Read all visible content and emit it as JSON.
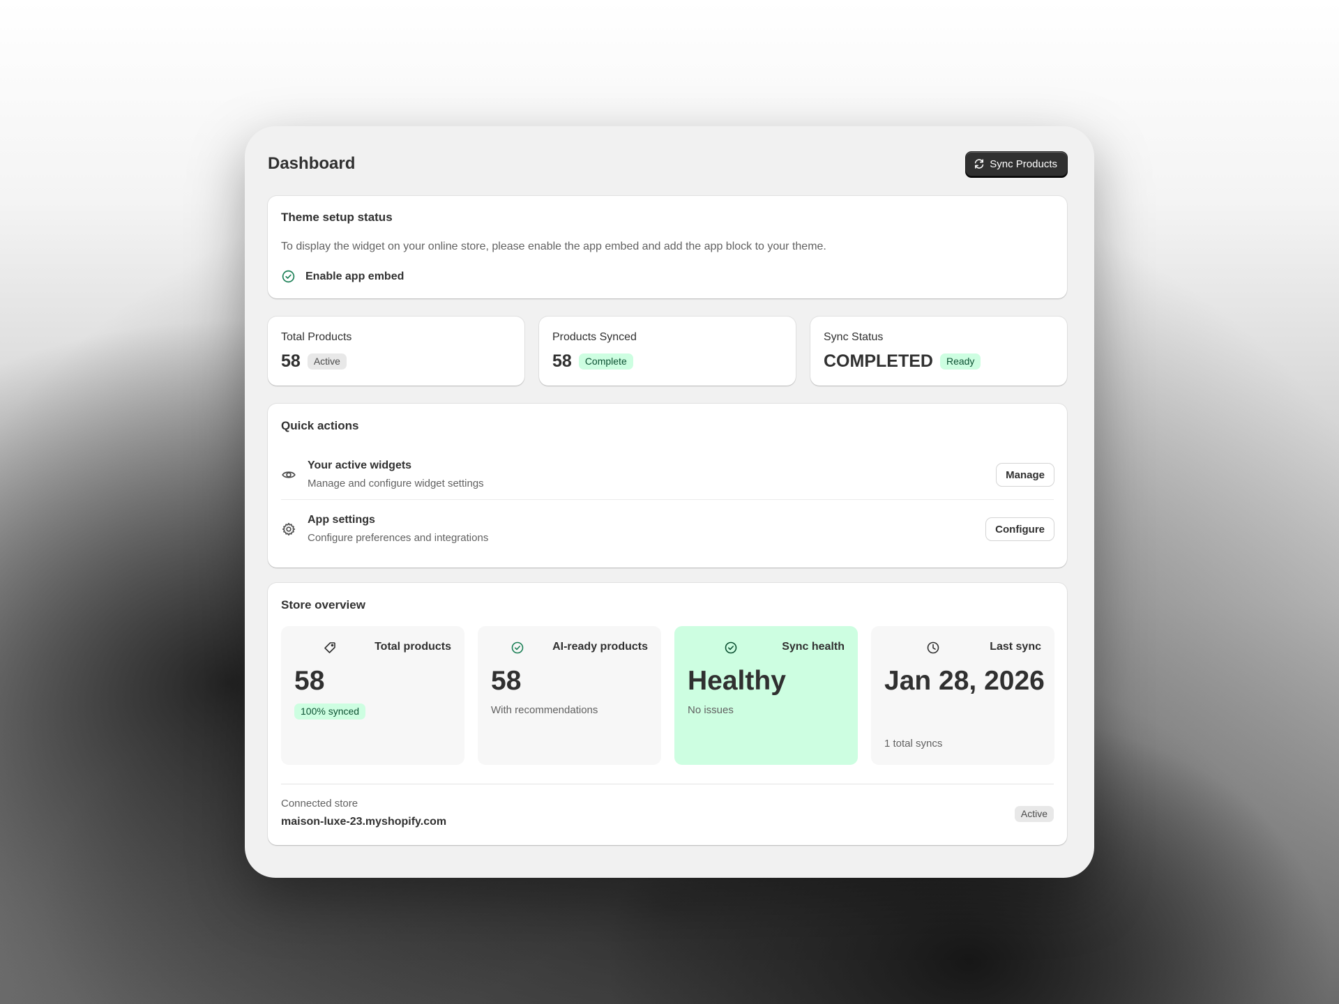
{
  "header": {
    "title": "Dashboard",
    "sync_button": "Sync Products"
  },
  "theme_setup": {
    "title": "Theme setup status",
    "description": "To display the widget on your online store, please enable the app embed and add the app block to your theme.",
    "embed_label": "Enable app embed"
  },
  "stats": [
    {
      "label": "Total Products",
      "value": "58",
      "badge": "Active"
    },
    {
      "label": "Products Synced",
      "value": "58",
      "badge": "Complete"
    },
    {
      "label": "Sync Status",
      "value": "COMPLETED",
      "badge": "Ready"
    }
  ],
  "quick_actions": {
    "title": "Quick actions",
    "items": [
      {
        "icon": "eye-icon",
        "title": "Your active widgets",
        "subtitle": "Manage and configure widget settings",
        "button": "Manage"
      },
      {
        "icon": "gear-icon",
        "title": "App settings",
        "subtitle": "Configure preferences and integrations",
        "button": "Configure"
      }
    ]
  },
  "overview": {
    "title": "Store overview",
    "tiles": [
      {
        "icon": "tag-icon",
        "label": "Total products",
        "value": "58",
        "badge": "100% synced"
      },
      {
        "icon": "check-circle-icon",
        "label": "AI-ready products",
        "value": "58",
        "sub": "With recommendations"
      },
      {
        "icon": "check-circle-icon",
        "label": "Sync health",
        "value": "Healthy",
        "sub": "No issues"
      },
      {
        "icon": "clock-icon",
        "label": "Last sync",
        "value": "Jan 28, 2026",
        "sub": "1 total syncs"
      }
    ],
    "store_label": "Connected store",
    "store_name": "maison-luxe-23.myshopify.com",
    "store_badge": "Active"
  },
  "colors": {
    "success_bg": "#cdfee1",
    "success_text": "#0c5132",
    "button_dark": "#303030",
    "icon_green": "#1a7f55"
  }
}
